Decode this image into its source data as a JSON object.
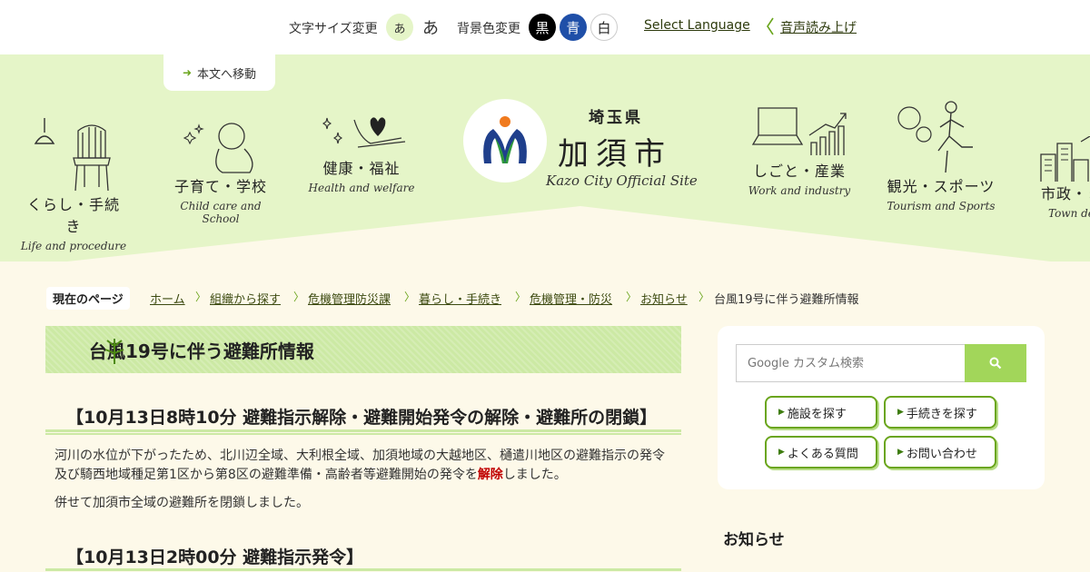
{
  "utility": {
    "font_size_label": "文字サイズ変更",
    "font_small": "あ",
    "font_large": "あ",
    "bg_label": "背景色変更",
    "bg_black": "黒",
    "bg_blue": "青",
    "bg_white": "白",
    "language": "Select Language",
    "read_aloud": "音声読み上げ"
  },
  "header": {
    "skip_link": "本文へ移動",
    "logo": {
      "prefecture": "埼玉県",
      "city": "加須市",
      "tagline": "Kazo City Official Site"
    },
    "nav": [
      {
        "jp": "くらし・手続き",
        "en": "Life and procedure"
      },
      {
        "jp": "子育て・学校",
        "en": "Child care and School"
      },
      {
        "jp": "健康・福祉",
        "en": "Health and welfare"
      },
      {
        "jp": "しごと・産業",
        "en": "Work and industry"
      },
      {
        "jp": "観光・スポーツ",
        "en": "Tourism and Sports"
      },
      {
        "jp": "市政・まちづくり",
        "en": "Town development"
      }
    ]
  },
  "breadcrumb": {
    "here_label": "現在のページ",
    "links": [
      "ホーム",
      "組織から探す",
      "危機管理防災課",
      "暮らし・手続き",
      "危機管理・防災",
      "お知らせ"
    ],
    "current": "台風19号に伴う避難所情報"
  },
  "main": {
    "title": "台風19号に伴う避難所情報",
    "section1": {
      "heading": "【10月13日8時10分 避難指示解除・避難開始発令の解除・避難所の閉鎖】",
      "para1_a": "河川の水位が下がったため、北川辺全域、大利根全域、加須地域の大越地区、樋遣川地区の避難指示の発令及び騎西地域種足第1区から第8区の避難準備・高齢者等避難開始の発令を",
      "para1_emph": "解除",
      "para1_b": "しました。",
      "para2": "併せて加須市全域の避難所を閉鎖しました。"
    },
    "section2": {
      "heading": "【10月13日2時00分 避難指示発令】"
    }
  },
  "sidebar": {
    "search_placeholder": "Google カスタム検索",
    "buttons": [
      "施設を探す",
      "手続きを探す",
      "よくある質問",
      "お問い合わせ"
    ],
    "news_heading": "お知らせ",
    "news_partial": "…"
  },
  "colors": {
    "header_bg": "#e5f5c8",
    "page_bg": "#fdf9e9",
    "accent": "#6aa51c",
    "accent_light": "#a2d65a",
    "emphasis": "#c00000"
  }
}
